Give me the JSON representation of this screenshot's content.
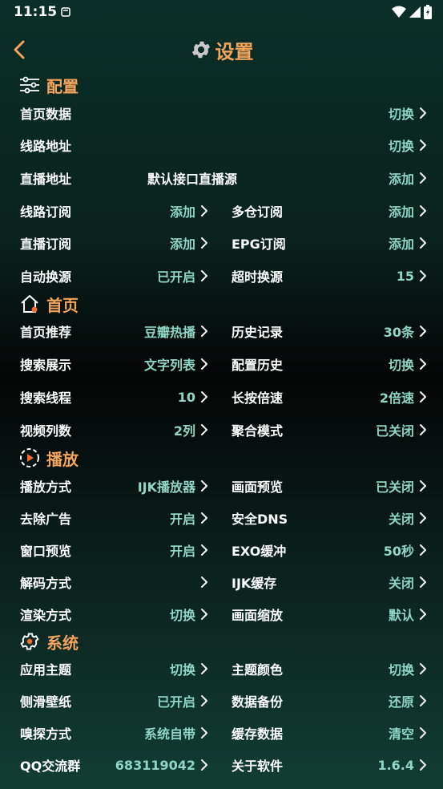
{
  "status": {
    "time": "11:15"
  },
  "header": {
    "title": "设置"
  },
  "sections": {
    "config": "配置",
    "home": "首页",
    "play": "播放",
    "system": "系统"
  },
  "config": {
    "home_data": {
      "label": "首页数据",
      "value": "切换"
    },
    "line_addr": {
      "label": "线路地址",
      "value": "切换"
    },
    "live_addr": {
      "label": "直播地址",
      "middle": "默认接口直播源",
      "value": "添加"
    },
    "line_sub": {
      "label": "线路订阅",
      "value": "添加"
    },
    "multi_sub": {
      "label": "多仓订阅",
      "value": "添加"
    },
    "live_sub": {
      "label": "直播订阅",
      "value": "添加"
    },
    "epg_sub": {
      "label": "EPG订阅",
      "value": "添加"
    },
    "auto_switch": {
      "label": "自动换源",
      "value": "已开启"
    },
    "timeout_switch": {
      "label": "超时换源",
      "value": "15"
    }
  },
  "home": {
    "recommend": {
      "label": "首页推荐",
      "value": "豆瓣热播"
    },
    "history": {
      "label": "历史记录",
      "value": "30条"
    },
    "search_display": {
      "label": "搜索展示",
      "value": "文字列表"
    },
    "config_history": {
      "label": "配置历史",
      "value": "切换"
    },
    "search_threads": {
      "label": "搜索线程",
      "value": "10"
    },
    "long_press_speed": {
      "label": "长按倍速",
      "value": "2倍速"
    },
    "video_columns": {
      "label": "视频列数",
      "value": "2列"
    },
    "aggregate_mode": {
      "label": "聚合模式",
      "value": "已关闭"
    }
  },
  "play": {
    "play_mode": {
      "label": "播放方式",
      "value": "IJK播放器"
    },
    "picture_preview": {
      "label": "画面预览",
      "value": "已关闭"
    },
    "remove_ads": {
      "label": "去除广告",
      "value": "开启"
    },
    "safe_dns": {
      "label": "安全DNS",
      "value": "关闭"
    },
    "window_preview": {
      "label": "窗口预览",
      "value": "开启"
    },
    "exo_buffer": {
      "label": "EXO缓冲",
      "value": "50秒"
    },
    "decode_mode": {
      "label": "解码方式",
      "value": ""
    },
    "ijk_cache": {
      "label": "IJK缓存",
      "value": "关闭"
    },
    "render_mode": {
      "label": "渲染方式",
      "value": "切换"
    },
    "picture_scale": {
      "label": "画面缩放",
      "value": "默认"
    }
  },
  "system": {
    "app_theme": {
      "label": "应用主题",
      "value": "切换"
    },
    "theme_color": {
      "label": "主题颜色",
      "value": "切换"
    },
    "side_wallpaper": {
      "label": "侧滑壁纸",
      "value": "已开启"
    },
    "data_backup": {
      "label": "数据备份",
      "value": "还原"
    },
    "sniff_mode": {
      "label": "嗅探方式",
      "value": "系统自带"
    },
    "cache_data": {
      "label": "缓存数据",
      "value": "清空"
    },
    "qq_group": {
      "label": "QQ交流群",
      "value": "683119042"
    },
    "about": {
      "label": "关于软件",
      "value": "1.6.4"
    }
  },
  "colors": {
    "accent": "#f2a35c",
    "value": "#8fd6c4",
    "text": "#ffffff"
  },
  "icons": {
    "back": "chevron-left-icon",
    "title": "gear-icon",
    "config": "sliders-icon",
    "home": "home-icon",
    "play": "play-circle-icon",
    "system": "gear-icon",
    "row": "chevron-right-icon"
  }
}
